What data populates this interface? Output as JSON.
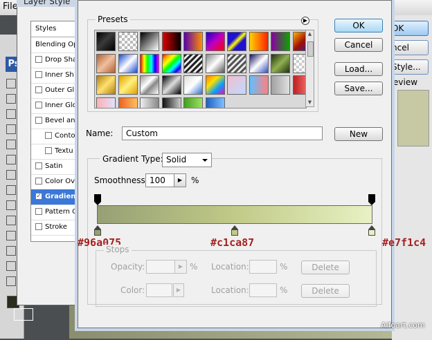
{
  "background": {
    "menu_file": "File",
    "ps_logo": "Ps",
    "right_buttons": [
      "OK",
      "ncel",
      "Style...",
      "eview"
    ],
    "watermark": "Alfoart.com"
  },
  "layer_style": {
    "title": "Layer Style",
    "header": "Styles",
    "rows": [
      {
        "label": "Blending Op",
        "check": null,
        "selected": false
      },
      {
        "label": "Drop Sha",
        "check": false,
        "selected": false
      },
      {
        "label": "Inner Sh",
        "check": false,
        "selected": false
      },
      {
        "label": "Outer Gl",
        "check": false,
        "selected": false
      },
      {
        "label": "Inner Glo",
        "check": false,
        "selected": false
      },
      {
        "label": "Bevel and",
        "check": false,
        "selected": false
      },
      {
        "label": "Conto",
        "check": false,
        "selected": false,
        "indent": true
      },
      {
        "label": "Textu",
        "check": false,
        "selected": false,
        "indent": true
      },
      {
        "label": "Satin",
        "check": false,
        "selected": false
      },
      {
        "label": "Color Ov",
        "check": false,
        "selected": false
      },
      {
        "label": "Gradient",
        "check": true,
        "selected": true
      },
      {
        "label": "Pattern O",
        "check": false,
        "selected": false
      },
      {
        "label": "Stroke",
        "check": false,
        "selected": false
      }
    ]
  },
  "gradient_editor": {
    "presets_title": "Presets",
    "buttons": {
      "ok": "OK",
      "cancel": "Cancel",
      "load": "Load...",
      "save": "Save...",
      "new": "New"
    },
    "name_label": "Name:",
    "name_value": "Custom",
    "gradient_type_label": "Gradient Type:",
    "gradient_type_value": "Solid",
    "smoothness_label": "Smoothness:",
    "smoothness_value": "100",
    "smoothness_unit": "%",
    "stops_title": "Stops",
    "opacity_label": "Opacity:",
    "opacity_unit": "%",
    "location_label": "Location:",
    "location_unit": "%",
    "delete_label": "Delete",
    "color_label": "Color:",
    "gradient": {
      "colors": [
        "#96a075",
        "#c1ca87",
        "#e7f1c4"
      ],
      "color_stop_labels": [
        "#96a075",
        "#c1ca87",
        "#e7f1c4"
      ],
      "color_stop_locations": [
        0,
        50,
        100
      ],
      "opacity_stop_locations": [
        0,
        100
      ]
    },
    "preset_swatches": [
      "linear-gradient(135deg,#000,#3a3a3a 45%,#000)",
      "repeating-conic-gradient(#bbb 0 25%,#fff 0 50%) 0 0/8px 8px",
      "linear-gradient(135deg,#000,#fff)",
      "linear-gradient(90deg,#e00000,#000)",
      "linear-gradient(90deg,#5a00b0,#ff9000)",
      "linear-gradient(135deg,#1a00d0,#c000c0,#ff0000)",
      "linear-gradient(135deg,#2010d0 35%,#ffff00 50%,#2010d0 65%)",
      "linear-gradient(90deg,#ffd000,#ff2000)",
      "linear-gradient(90deg,#8a00a0,#10a000)",
      "linear-gradient(135deg,#ffb000,#a01000 50%,#2020c0)",
      "linear-gradient(135deg,#b06030,#f0c0a0 50%,#b06030)",
      "linear-gradient(135deg,#1a4ad0,#ffffff 50%,#1a4ad0)",
      "linear-gradient(90deg,red,yellow,lime,cyan,blue,magenta)",
      "linear-gradient(135deg,red,orange,yellow,lime,cyan,blue,violet)",
      "repeating-linear-gradient(135deg,#222 0 3px,#eee 3px 6px)",
      "linear-gradient(135deg,#888,#fff 50%,#555)",
      "repeating-linear-gradient(135deg,#555 0 3px,#eee 3px 6px)",
      "linear-gradient(135deg,#101060,#fff 50%,#3050c0)",
      "linear-gradient(135deg,#203010,#90b050 50%,#203010)",
      "repeating-conic-gradient(#ccc 0 25%,#fff 0 50%) 0 0/8px 8px",
      "linear-gradient(135deg,#b08010,#ffe070 50%,#b08010)",
      "linear-gradient(135deg,#e0a000,#fff080 50%,#e0a000)",
      "linear-gradient(135deg,#999,#fff 40%,#888 60%,#fff)",
      "linear-gradient(135deg,#000,#ddd 50%,#000)",
      "linear-gradient(135deg,#dddddd,#fff 50%,#3070d0)",
      "linear-gradient(135deg,#ff8000,#ffe000,#00a0ff,#ff00c0)",
      "linear-gradient(135deg,#f0c0d0,#c0d8ff)",
      "linear-gradient(90deg,#60c0ff,#ff8080)",
      "linear-gradient(90deg,#a0a0a0,#e0e0e0)",
      "linear-gradient(90deg,#c02020,#ff8080)",
      "linear-gradient(90deg,#ffb0b0,#e0e0ff)",
      "linear-gradient(90deg,#f06020,#ffc060)",
      "linear-gradient(90deg,#eee,#888)",
      "linear-gradient(90deg,#111,#ccc)",
      "linear-gradient(90deg,#40a020,#a0e060)",
      "linear-gradient(90deg,#2060c0,#80c0ff)"
    ]
  }
}
